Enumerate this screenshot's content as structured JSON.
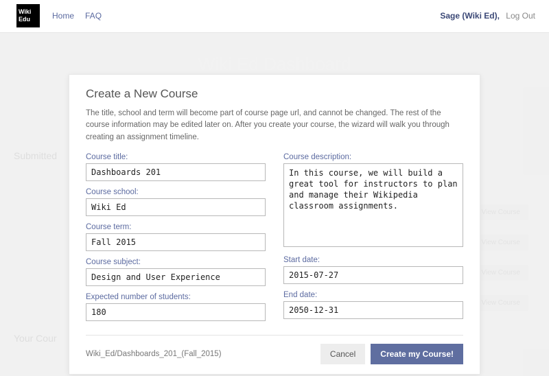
{
  "nav": {
    "home": "Home",
    "faq": "FAQ",
    "user": "Sage (Wiki Ed)",
    "logout": "Log Out",
    "logo_line1": "Wiki",
    "logo_line2": "Edu"
  },
  "bg": {
    "title": "Wiki Ed Dashboard",
    "submitted": "Submitted",
    "your_courses": "Your Cour",
    "view_course": "View Course"
  },
  "modal": {
    "title": "Create a New Course",
    "intro": "The title, school and term will become part of course page url, and cannot be changed. The rest of the course information may be edited later on. After you create your course, the wizard will walk you through creating an assignment timeline.",
    "labels": {
      "course_title": "Course title:",
      "course_school": "Course school:",
      "course_term": "Course term:",
      "course_subject": "Course subject:",
      "expected_students": "Expected number of students:",
      "course_description": "Course description:",
      "start_date": "Start date:",
      "end_date": "End date:"
    },
    "values": {
      "course_title": "Dashboards 201",
      "course_school": "Wiki Ed",
      "course_term": "Fall 2015",
      "course_subject": "Design and User Experience",
      "expected_students": "180",
      "course_description": "In this course, we will build a great tool for instructors to plan and manage their Wikipedia classroom assignments.",
      "start_date": "2015-07-27",
      "end_date": "2050-12-31"
    },
    "slug": "Wiki_Ed/Dashboards_201_(Fall_2015)",
    "cancel": "Cancel",
    "create": "Create my Course!"
  }
}
